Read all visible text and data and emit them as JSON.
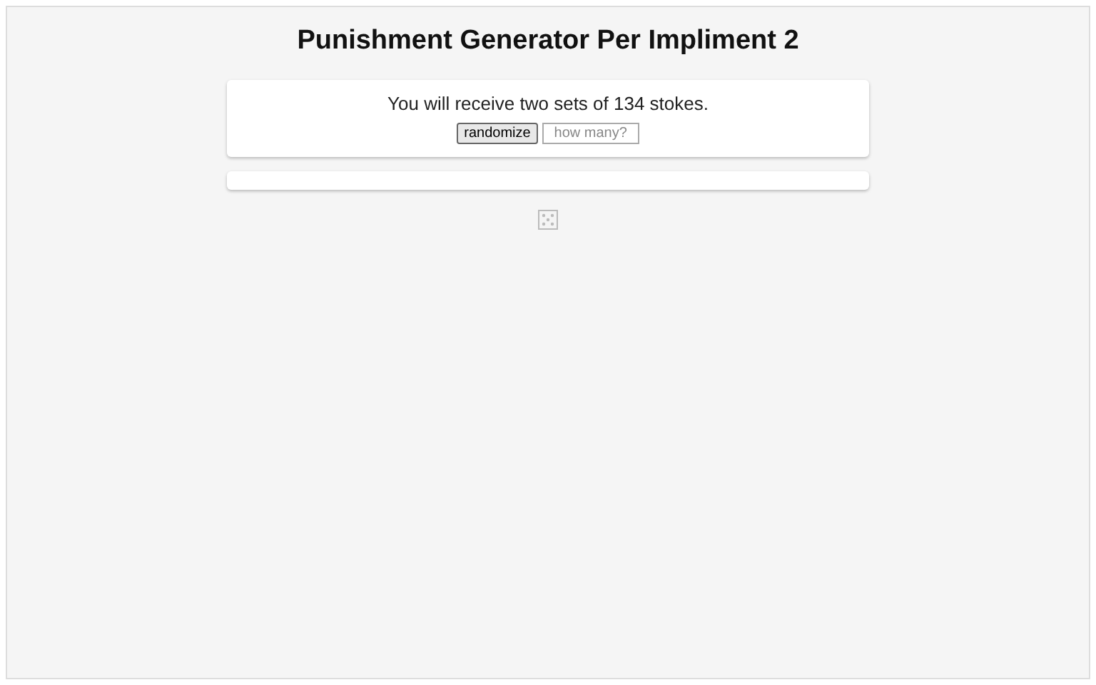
{
  "title": "Punishment Generator Per Impliment 2",
  "result": "You will receive two sets of 134 stokes.",
  "randomize_button": "randomize",
  "count_field": {
    "placeholder": "how many?"
  }
}
